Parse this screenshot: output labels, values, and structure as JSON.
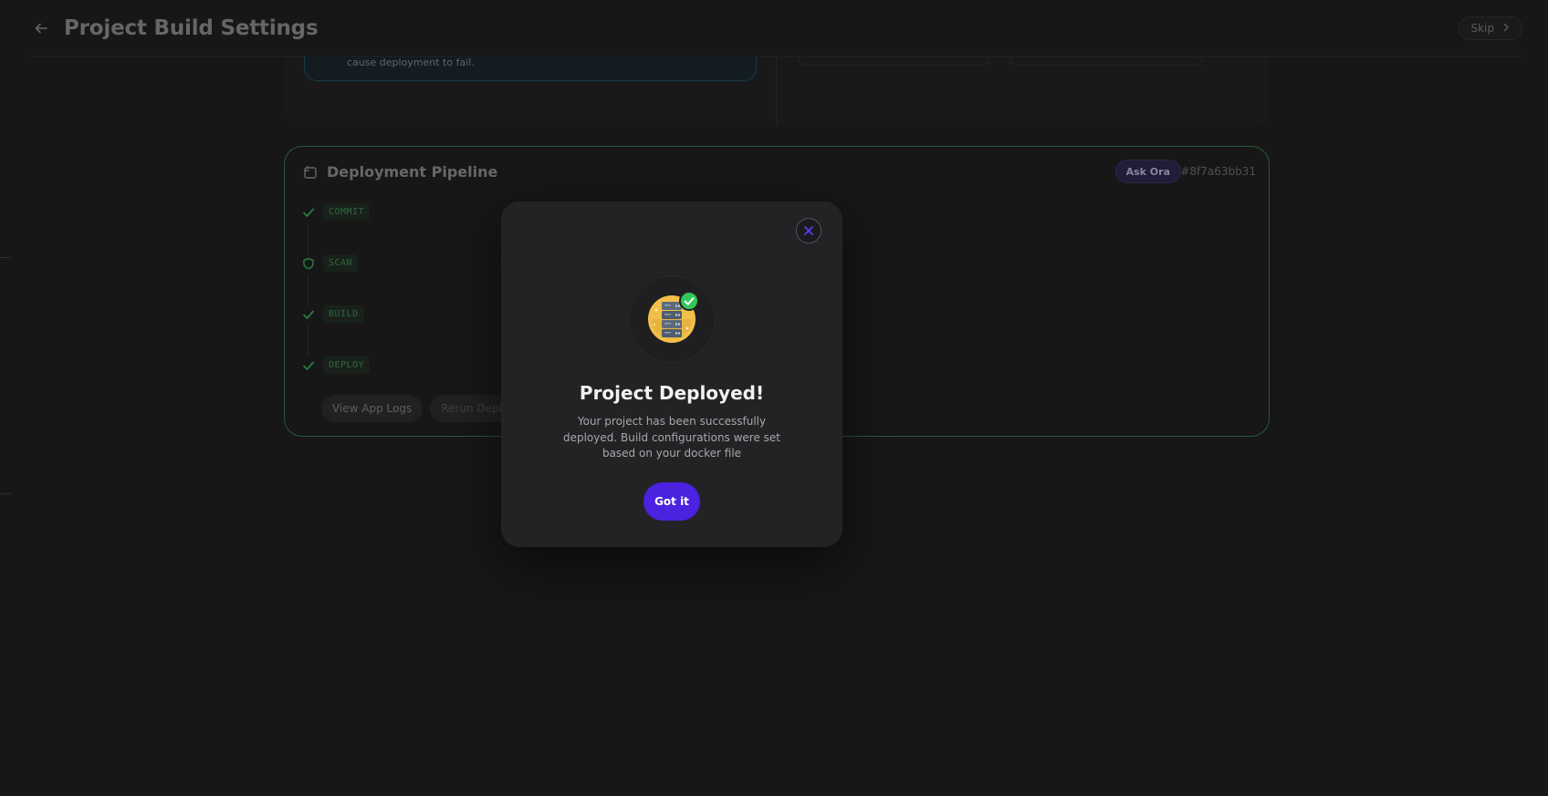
{
  "header": {
    "title": "Project Build Settings",
    "skip_label": "Skip"
  },
  "settings_card": {
    "info_text": "cause deployment to fail."
  },
  "pipeline": {
    "title": "Deployment Pipeline",
    "ask_label": "Ask Ora",
    "commit_hash": "#8f7a63bb31",
    "steps": [
      {
        "label": "COMMIT",
        "icon": "check-icon",
        "status": "done"
      },
      {
        "label": "SCAN",
        "icon": "shield-icon",
        "status": "done"
      },
      {
        "label": "BUILD",
        "icon": "check-icon",
        "status": "done"
      },
      {
        "label": "DEPLOY",
        "icon": "check-icon",
        "status": "done"
      }
    ],
    "buttons": {
      "logs_label": "View App Logs",
      "rerun_label": "Rerun Deploy"
    }
  },
  "modal": {
    "title": "Project Deployed!",
    "body": "Your project has been successfully deployed. Build configurations were set based on your docker file",
    "confirm_label": "Got it",
    "illustration": "server-check-icon"
  },
  "colors": {
    "accent": "#4a22e0",
    "success": "#34c759",
    "pipeline_border": "#2f7a48"
  }
}
